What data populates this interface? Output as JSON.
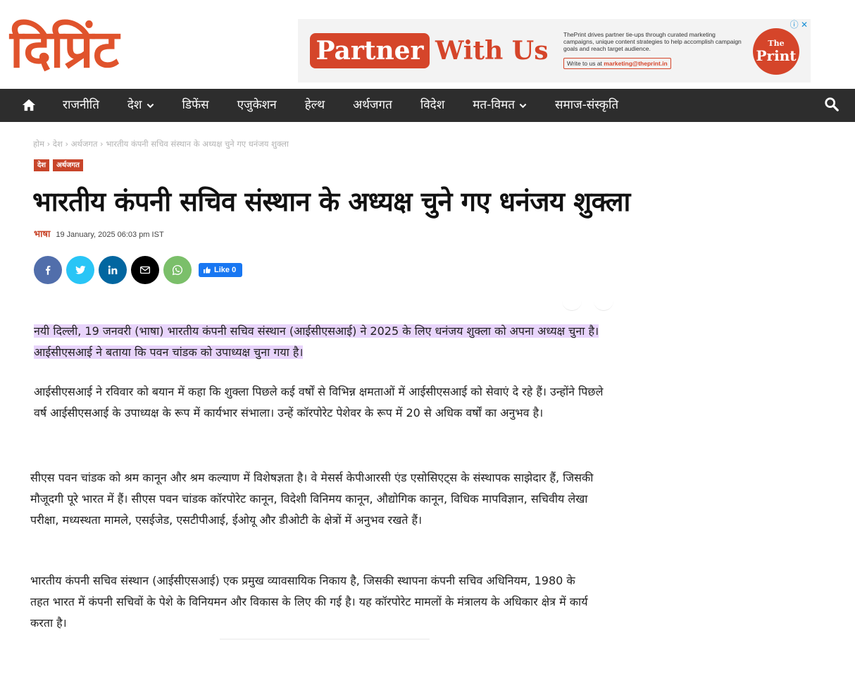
{
  "header": {
    "logo_text": "दिप्रिंट",
    "ad": {
      "pill_text": "Partner",
      "with_text": "With Us",
      "description": "ThePrint drives partner tie-ups through curated marketing campaigns, unique content strategies to help accomplish  campaign goals and reach target audience.",
      "mail_prefix": "Write to us at ",
      "mail_address": "marketing@theprint.in",
      "badge_line1": "The",
      "badge_line2": "Print",
      "close_glyph": "ⓘ ✕"
    }
  },
  "nav": {
    "items": [
      {
        "label": "राजनीति",
        "dropdown": false
      },
      {
        "label": "देश",
        "dropdown": true
      },
      {
        "label": "डिफेंस",
        "dropdown": false
      },
      {
        "label": "एजुकेशन",
        "dropdown": false
      },
      {
        "label": "हेल्थ",
        "dropdown": false
      },
      {
        "label": "अर्थजगत",
        "dropdown": false
      },
      {
        "label": "विदेश",
        "dropdown": false
      },
      {
        "label": "मत-विमत",
        "dropdown": true
      },
      {
        "label": "समाज-संस्कृति",
        "dropdown": false
      }
    ]
  },
  "article": {
    "breadcrumb": "होम › देश › अर्थजगत › भारतीय कंपनी सचिव संस्थान के अध्यक्ष चुने गए धनंजय शुक्ला",
    "tags": [
      "देश",
      "अर्थजगत"
    ],
    "title": "भारतीय कंपनी सचिव संस्थान के अध्यक्ष चुने गए धनंजय शुक्ला",
    "author": "भाषा",
    "date": "19 January, 2025 06:03 pm IST",
    "like_label": "Like 0",
    "paragraphs": [
      "नयी दिल्ली, 19 जनवरी (भाषा) भारतीय कंपनी सचिव संस्थान (आईसीएसआई) ने 2025 के लिए धनंजय शुक्ला को अपना अध्यक्ष चुना है। आईसीएसआई ने बताया कि पवन चांडक को उपाध्यक्ष चुना गया है।",
      "आईसीएसआई ने रविवार को बयान में कहा कि शुक्ला पिछले कई वर्षों से विभिन्न क्षमताओं में आईसीएसआई को सेवाएं दे रहे हैं। उन्होंने पिछले वर्ष आईसीएसआई के उपाध्यक्ष के रूप में कार्यभार संभाला। उन्हें कॉरपोरेट पेशेवर के रूप में 20 से अधिक वर्षों का अनुभव है।",
      "सीएस पवन चांडक को श्रम कानून और श्रम कल्याण में विशेषज्ञता है। वे मेसर्स केपीआरसी एंड एसोसिएट्स के संस्थापक साझेदार हैं, जिसकी मौजूदगी पूरे भारत में हैं। सीएस पवन चांडक कॉरपोरेट कानून, विदेशी विनिमय कानून, औद्योगिक कानून, विधिक मापविज्ञान, सचिवीय लेखा परीक्षा, मध्यस्थता मामले, एसईजेड, एसटीपीआई, ईओयू और डीओटी के क्षेत्रों में अनुभव रखते हैं।",
      "भारतीय कंपनी सचिव संस्थान (आईसीएसआई) एक प्रमुख व्यावसायिक निकाय है, जिसकी स्थापना कंपनी सचिव अधिनियम, 1980 के तहत भारत में कंपनी सचिवों के पेशे के विनियमन और विकास के लिए की गई है। यह कॉरपोरेट मामलों के मंत्रालय के अधिकार क्षेत्र में कार्य करता है।"
    ]
  },
  "colors": {
    "brand": "#e0532c",
    "nav_bg": "#2d2d2d",
    "highlight": "#e8d4fb"
  }
}
